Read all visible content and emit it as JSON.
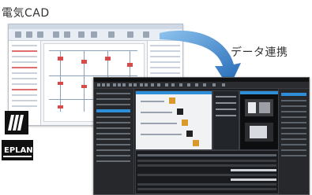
{
  "captions": {
    "electric_cad": "電気CAD",
    "data_link": "データ連携"
  },
  "logo": {
    "brand_text": "EPLAN"
  },
  "colors": {
    "arrow": "#2f7ac8",
    "cad_accent": "#d94a4a",
    "dark_bg": "#1e1f22",
    "selection": "#2e8fd8"
  },
  "icons": {
    "arrow": "curved-arrow-icon",
    "logo_mark": "eplan-slash-icon"
  }
}
